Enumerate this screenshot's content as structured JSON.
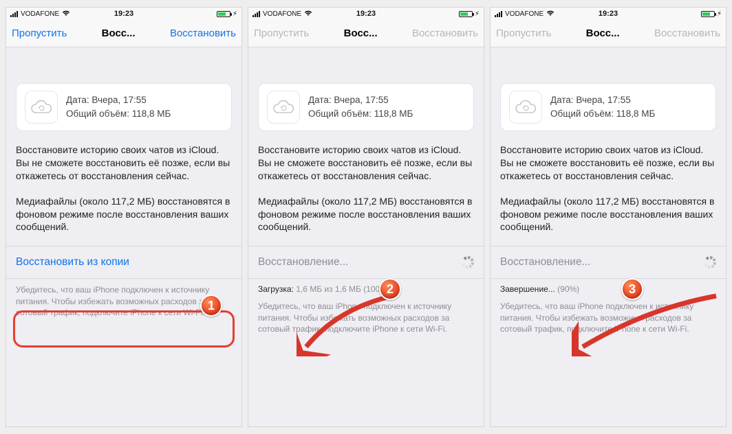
{
  "status": {
    "carrier": "VODAFONE",
    "time": "19:23"
  },
  "nav": {
    "skip": "Пропустить",
    "title": "Восс...",
    "restore": "Восстановить"
  },
  "backup": {
    "date_label": "Дата: Вчера, 17:55",
    "size_label": "Общий объём: 118,8 МБ"
  },
  "body": {
    "p1": "Восстановите историю своих чатов из iCloud. Вы не сможете восстановить её позже, если вы откажетесь от восстановления сейчас.",
    "p2": "Медиафайлы (около 117,2 МБ) восстановятся в фоновом режиме после восстановления ваших сообщений."
  },
  "phones": [
    {
      "restore_label": "Восстановить из копии",
      "status_line": "",
      "hint": "Убедитесь, что ваш iPhone подключен к источнику питания. Чтобы избежать возможных расходов за сотовый трафик, подключите iPhone к сети Wi-Fi.",
      "step": "1"
    },
    {
      "restore_label": "Восстановление...",
      "status_key": "Загрузка:",
      "status_val": "1,6 МБ из 1,6 МБ (100%)",
      "hint": "Убедитесь, что ваш iPhone подключен к источнику питания. Чтобы избежать возможных расходов за сотовый трафик, подключите iPhone к сети Wi-Fi.",
      "step": "2"
    },
    {
      "restore_label": "Восстановление...",
      "status_key": "Завершение...",
      "status_val": "(90%)",
      "hint": "Убедитесь, что ваш iPhone подключен к источнику питания. Чтобы избежать возможных расходов за сотовый трафик, подключите iPhone к сети Wi-Fi.",
      "step": "3"
    }
  ]
}
